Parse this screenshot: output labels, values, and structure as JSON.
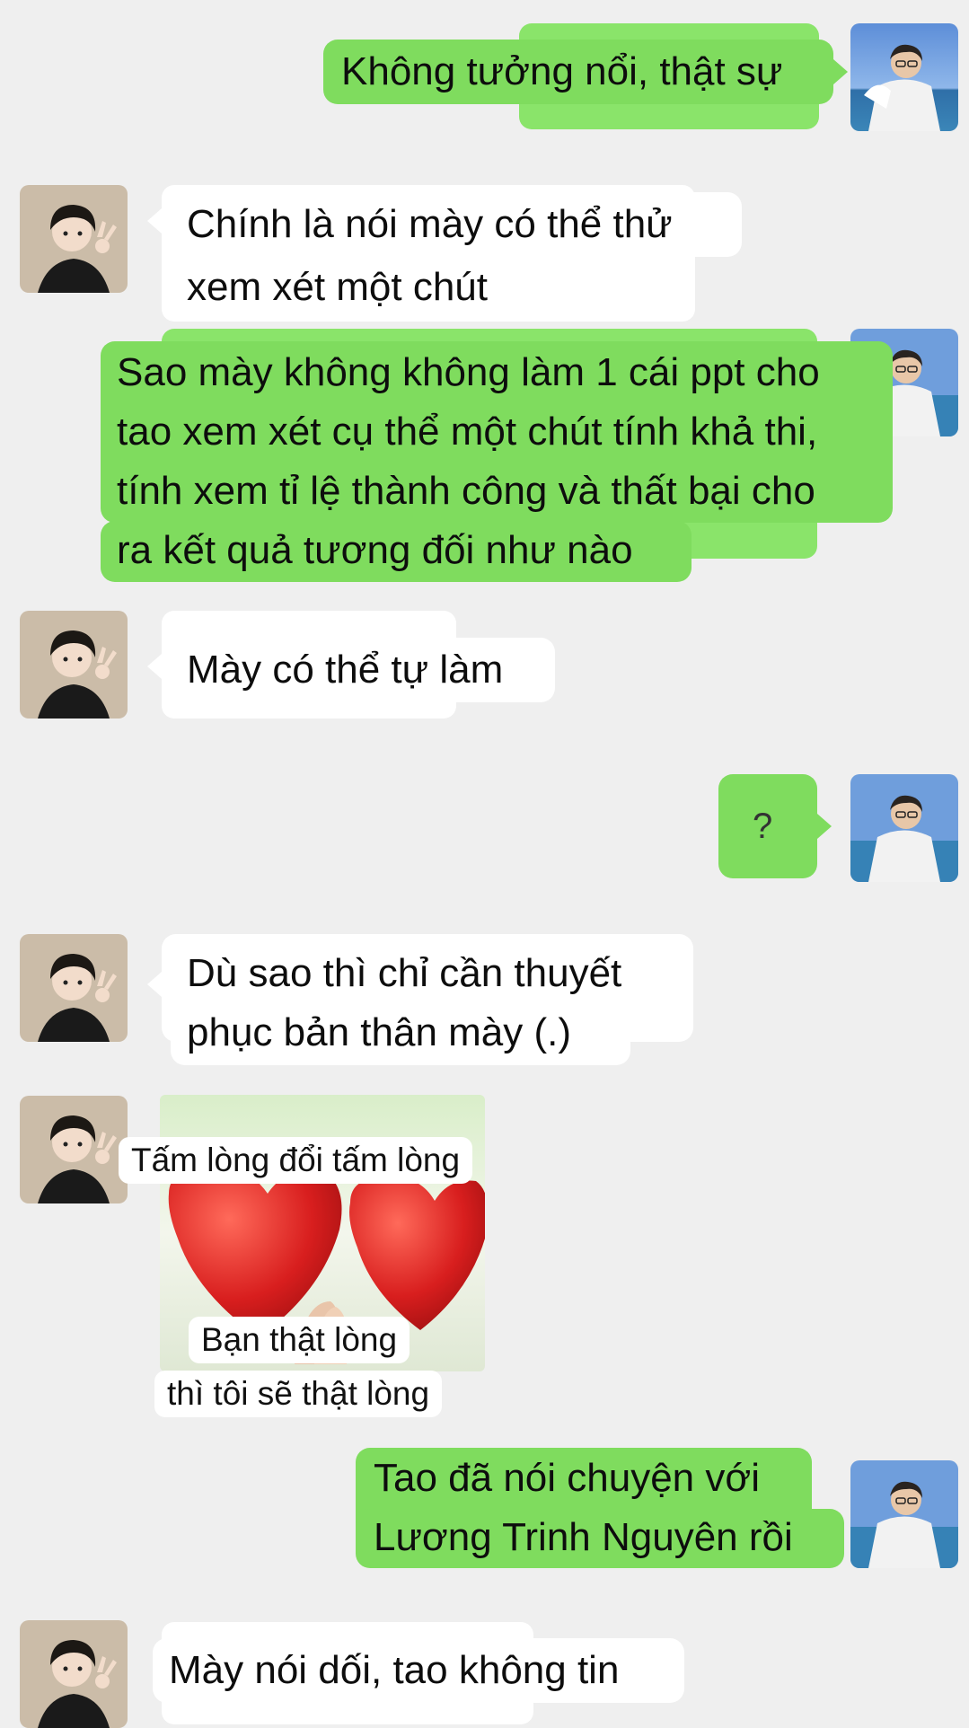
{
  "avatars": {
    "me": {
      "icon": "man-at-sea-avatar"
    },
    "friend": {
      "icon": "boy-peace-sign-avatar"
    }
  },
  "colors": {
    "background": "#efefef",
    "sent_bubble": "#7fdc5e",
    "received_bubble": "#ffffff"
  },
  "messages": [
    {
      "from": "me",
      "lines": [
        "Không tưởng nổi, thật sự"
      ]
    },
    {
      "from": "friend",
      "lines": [
        "Chính là nói mày có thể thử",
        "xem xét một chút"
      ]
    },
    {
      "from": "me",
      "lines": [
        "Sao mày không không làm 1 cái ppt cho",
        "tao xem xét cụ thể một chút tính khả thi,",
        "tính xem tỉ lệ thành công và thất bại cho",
        "ra kết quả tương đối như nào"
      ]
    },
    {
      "from": "friend",
      "lines": [
        "Mày có thể tự làm"
      ]
    },
    {
      "from": "me",
      "lines": [
        "?"
      ]
    },
    {
      "from": "friend",
      "lines": [
        "Dù sao thì chỉ cần thuyết",
        "phục bản thân mày (.)"
      ]
    },
    {
      "from": "friend",
      "sticker": {
        "top_text": "Tấm lòng đổi tấm lòng",
        "bottom_lines": [
          "Bạn thật lòng",
          "thì tôi sẽ thật lòng"
        ],
        "icon": "two-red-hearts-sticker"
      }
    },
    {
      "from": "me",
      "lines": [
        "Tao đã nói chuyện với",
        "Lương Trinh Nguyên rồi"
      ]
    },
    {
      "from": "friend",
      "lines": [
        "Mày nói dối, tao không tin"
      ]
    }
  ]
}
